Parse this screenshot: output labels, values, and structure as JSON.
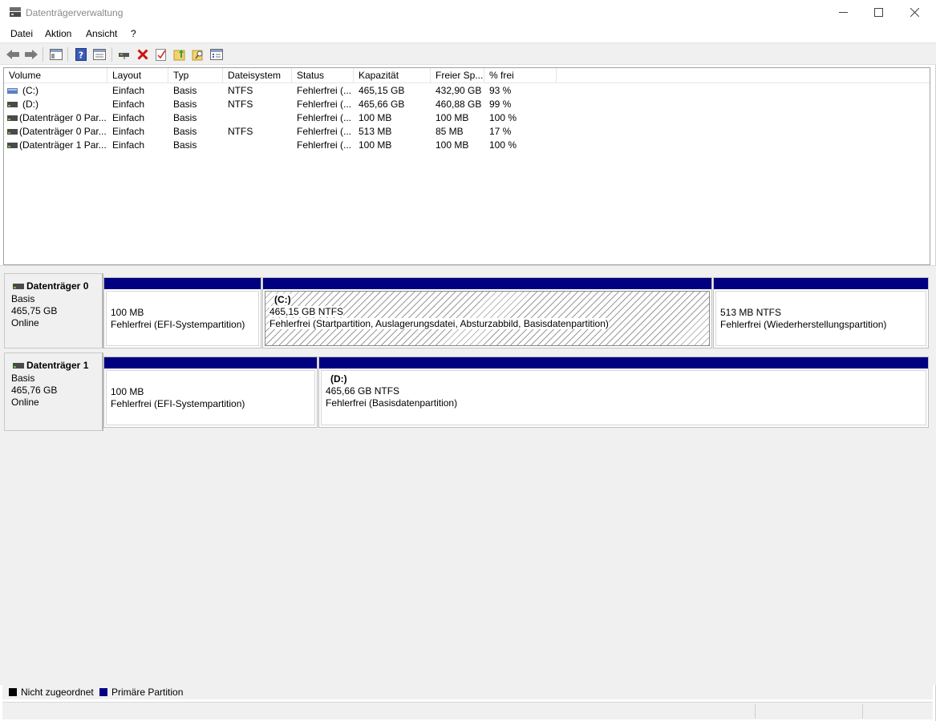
{
  "window": {
    "title": "Datenträgerverwaltung"
  },
  "menu": [
    "Datei",
    "Aktion",
    "Ansicht",
    "?"
  ],
  "toolbar": {
    "icons": [
      "back-arrow-icon",
      "forward-arrow-icon",
      "console-tree-icon",
      "help-icon",
      "properties-icon",
      "connect-disk-icon",
      "delete-icon",
      "check-icon",
      "folder-up-icon",
      "folder-search-icon",
      "settings-panel-icon"
    ]
  },
  "volume_table": {
    "columns": [
      "Volume",
      "Layout",
      "Typ",
      "Dateisystem",
      "Status",
      "Kapazität",
      "Freier Sp...",
      "% frei"
    ],
    "rows": [
      {
        "volume": "(C:)",
        "layout": "Einfach",
        "typ": "Basis",
        "fs": "NTFS",
        "status": "Fehlerfrei (...",
        "kap": "465,15 GB",
        "frei": "432,90 GB",
        "pct": "93 %"
      },
      {
        "volume": "(D:)",
        "layout": "Einfach",
        "typ": "Basis",
        "fs": "NTFS",
        "status": "Fehlerfrei (...",
        "kap": "465,66 GB",
        "frei": "460,88 GB",
        "pct": "99 %"
      },
      {
        "volume": "(Datenträger 0 Par...",
        "layout": "Einfach",
        "typ": "Basis",
        "fs": "",
        "status": "Fehlerfrei (...",
        "kap": "100 MB",
        "frei": "100 MB",
        "pct": "100 %"
      },
      {
        "volume": "(Datenträger 0 Par...",
        "layout": "Einfach",
        "typ": "Basis",
        "fs": "NTFS",
        "status": "Fehlerfrei (...",
        "kap": "513 MB",
        "frei": "85 MB",
        "pct": "17 %"
      },
      {
        "volume": "(Datenträger 1 Par...",
        "layout": "Einfach",
        "typ": "Basis",
        "fs": "",
        "status": "Fehlerfrei (...",
        "kap": "100 MB",
        "frei": "100 MB",
        "pct": "100 %"
      }
    ]
  },
  "disks": [
    {
      "name": "Datenträger 0",
      "type": "Basis",
      "size": "465,75 GB",
      "state": "Online",
      "partitions": [
        {
          "title": "",
          "size": "100 MB",
          "status": "Fehlerfrei (EFI-Systempartition)"
        },
        {
          "title": "(C:)",
          "size": "465,15 GB NTFS",
          "status": "Fehlerfrei (Startpartition, Auslagerungsdatei, Absturzabbild, Basisdatenpartition)"
        },
        {
          "title": "",
          "size": "513 MB NTFS",
          "status": "Fehlerfrei (Wiederherstellungspartition)"
        }
      ]
    },
    {
      "name": "Datenträger 1",
      "type": "Basis",
      "size": "465,76 GB",
      "state": "Online",
      "partitions": [
        {
          "title": "",
          "size": "100 MB",
          "status": "Fehlerfrei (EFI-Systempartition)"
        },
        {
          "title": "(D:)",
          "size": "465,66 GB NTFS",
          "status": "Fehlerfrei (Basisdatenpartition)"
        }
      ]
    }
  ],
  "legend": [
    {
      "label": "Nicht zugeordnet",
      "color": "#000000"
    },
    {
      "label": "Primäre Partition",
      "color": "#000080"
    }
  ],
  "colors": {
    "partition_bar": "#000080",
    "selected_hatch": "#9a9a9a"
  }
}
